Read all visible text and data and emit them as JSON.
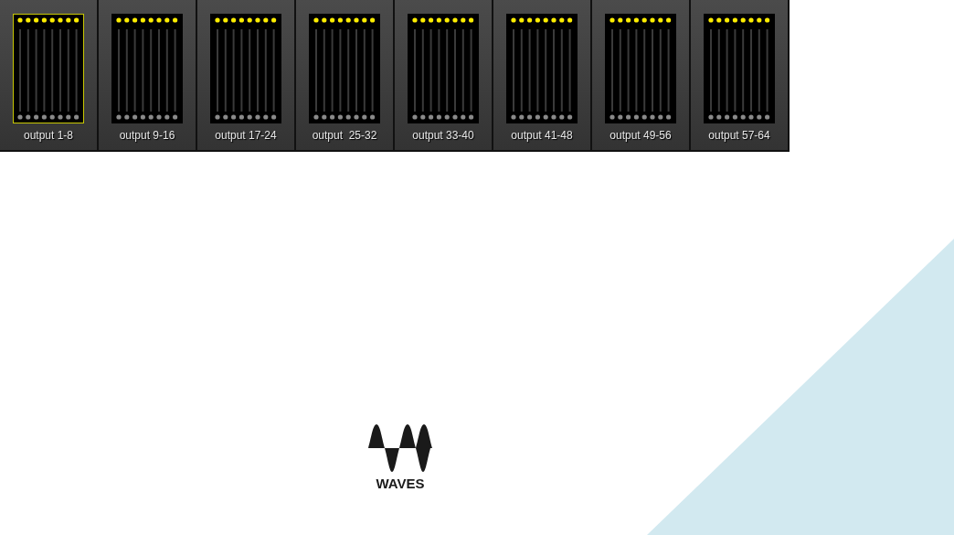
{
  "outputs": [
    {
      "label": "output 1-8",
      "selected": true
    },
    {
      "label": "output 9-16",
      "selected": false
    },
    {
      "label": "output 17-24",
      "selected": false
    },
    {
      "label": "output  25-32",
      "selected": false
    },
    {
      "label": "output 33-40",
      "selected": false
    },
    {
      "label": "output 41-48",
      "selected": false
    },
    {
      "label": "output 49-56",
      "selected": false
    },
    {
      "label": "output 57-64",
      "selected": false
    }
  ],
  "logo": {
    "text": "WAVES"
  }
}
